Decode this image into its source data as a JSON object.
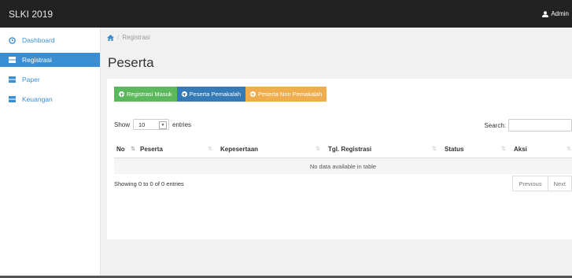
{
  "app": {
    "brand": "SLKI 2019",
    "user": "Admin"
  },
  "sidebar": {
    "items": [
      {
        "label": "Dashboard",
        "icon": "dashboard-icon"
      },
      {
        "label": "Registrasi",
        "icon": "grid-icon",
        "active": true
      },
      {
        "label": "Paper",
        "icon": "grid-icon"
      },
      {
        "label": "Keuangan",
        "icon": "grid-icon"
      }
    ]
  },
  "breadcrumb": {
    "home_icon": "home-icon",
    "current": "Registrasi"
  },
  "page": {
    "title": "Peserta"
  },
  "buttons": {
    "registrasi_masuk": "Registrasi Masuk",
    "peserta_pemakalah": "Peserta Pemakalah",
    "peserta_non_pemakalah": "Peserta Non Pemakalah"
  },
  "table_controls": {
    "show_label": "Show",
    "entries_value": "10",
    "entries_label": "entries",
    "search_label": "Search:"
  },
  "table": {
    "columns": [
      "No",
      "Peserta",
      "Kepesertaan",
      "Tgl. Registrasi",
      "Status",
      "Aksi"
    ],
    "empty_message": "No data available in table",
    "info": "Showing 0 to 0 of 0 entries"
  },
  "pagination": {
    "previous": "Previous",
    "next": "Next"
  },
  "colors": {
    "topbar": "#222222",
    "sidebar_active": "#3a8fd4",
    "btn_green": "#5cb85c",
    "btn_blue": "#337ab7",
    "btn_orange": "#f0ad4e"
  }
}
